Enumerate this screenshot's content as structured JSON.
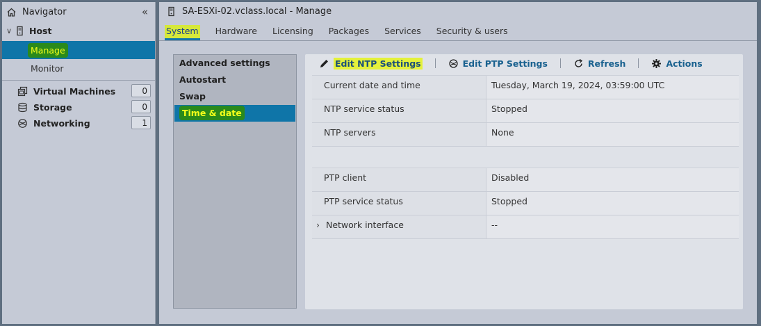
{
  "navigator": {
    "title": "Navigator",
    "collapse_glyph": "«",
    "host": {
      "label": "Host",
      "expanded_glyph": "∨"
    },
    "manage": "Manage",
    "monitor": "Monitor",
    "items": [
      {
        "label": "Virtual Machines",
        "count": "0",
        "icon": "vm-icon"
      },
      {
        "label": "Storage",
        "count": "0",
        "icon": "storage-icon"
      },
      {
        "label": "Networking",
        "count": "1",
        "icon": "networking-icon"
      }
    ]
  },
  "main": {
    "title": "SA-ESXi-02.vclass.local - Manage",
    "tabs": [
      "System",
      "Hardware",
      "Licensing",
      "Packages",
      "Services",
      "Security & users"
    ],
    "active_tab": "System"
  },
  "settings_list": {
    "items": [
      "Advanced settings",
      "Autostart",
      "Swap",
      "Time & date"
    ],
    "active": "Time & date"
  },
  "toolbar": {
    "edit_ntp": "Edit NTP Settings",
    "edit_ptp": "Edit PTP Settings",
    "refresh": "Refresh",
    "actions": "Actions"
  },
  "ntp_rows": [
    {
      "key": "Current date and time",
      "value": "Tuesday, March 19, 2024, 03:59:00 UTC"
    },
    {
      "key": "NTP service status",
      "value": "Stopped"
    },
    {
      "key": "NTP servers",
      "value": "None"
    }
  ],
  "ptp_rows": [
    {
      "key": "PTP client",
      "value": "Disabled"
    },
    {
      "key": "PTP service status",
      "value": "Stopped"
    },
    {
      "key": "Network interface",
      "value": "--",
      "expand_glyph": "›"
    }
  ],
  "colors": {
    "selected_bg": "#0f75a8",
    "highlight_green": "#2a8a1b",
    "highlight_yellow": "#e4f13b",
    "link_blue": "#19618f"
  }
}
